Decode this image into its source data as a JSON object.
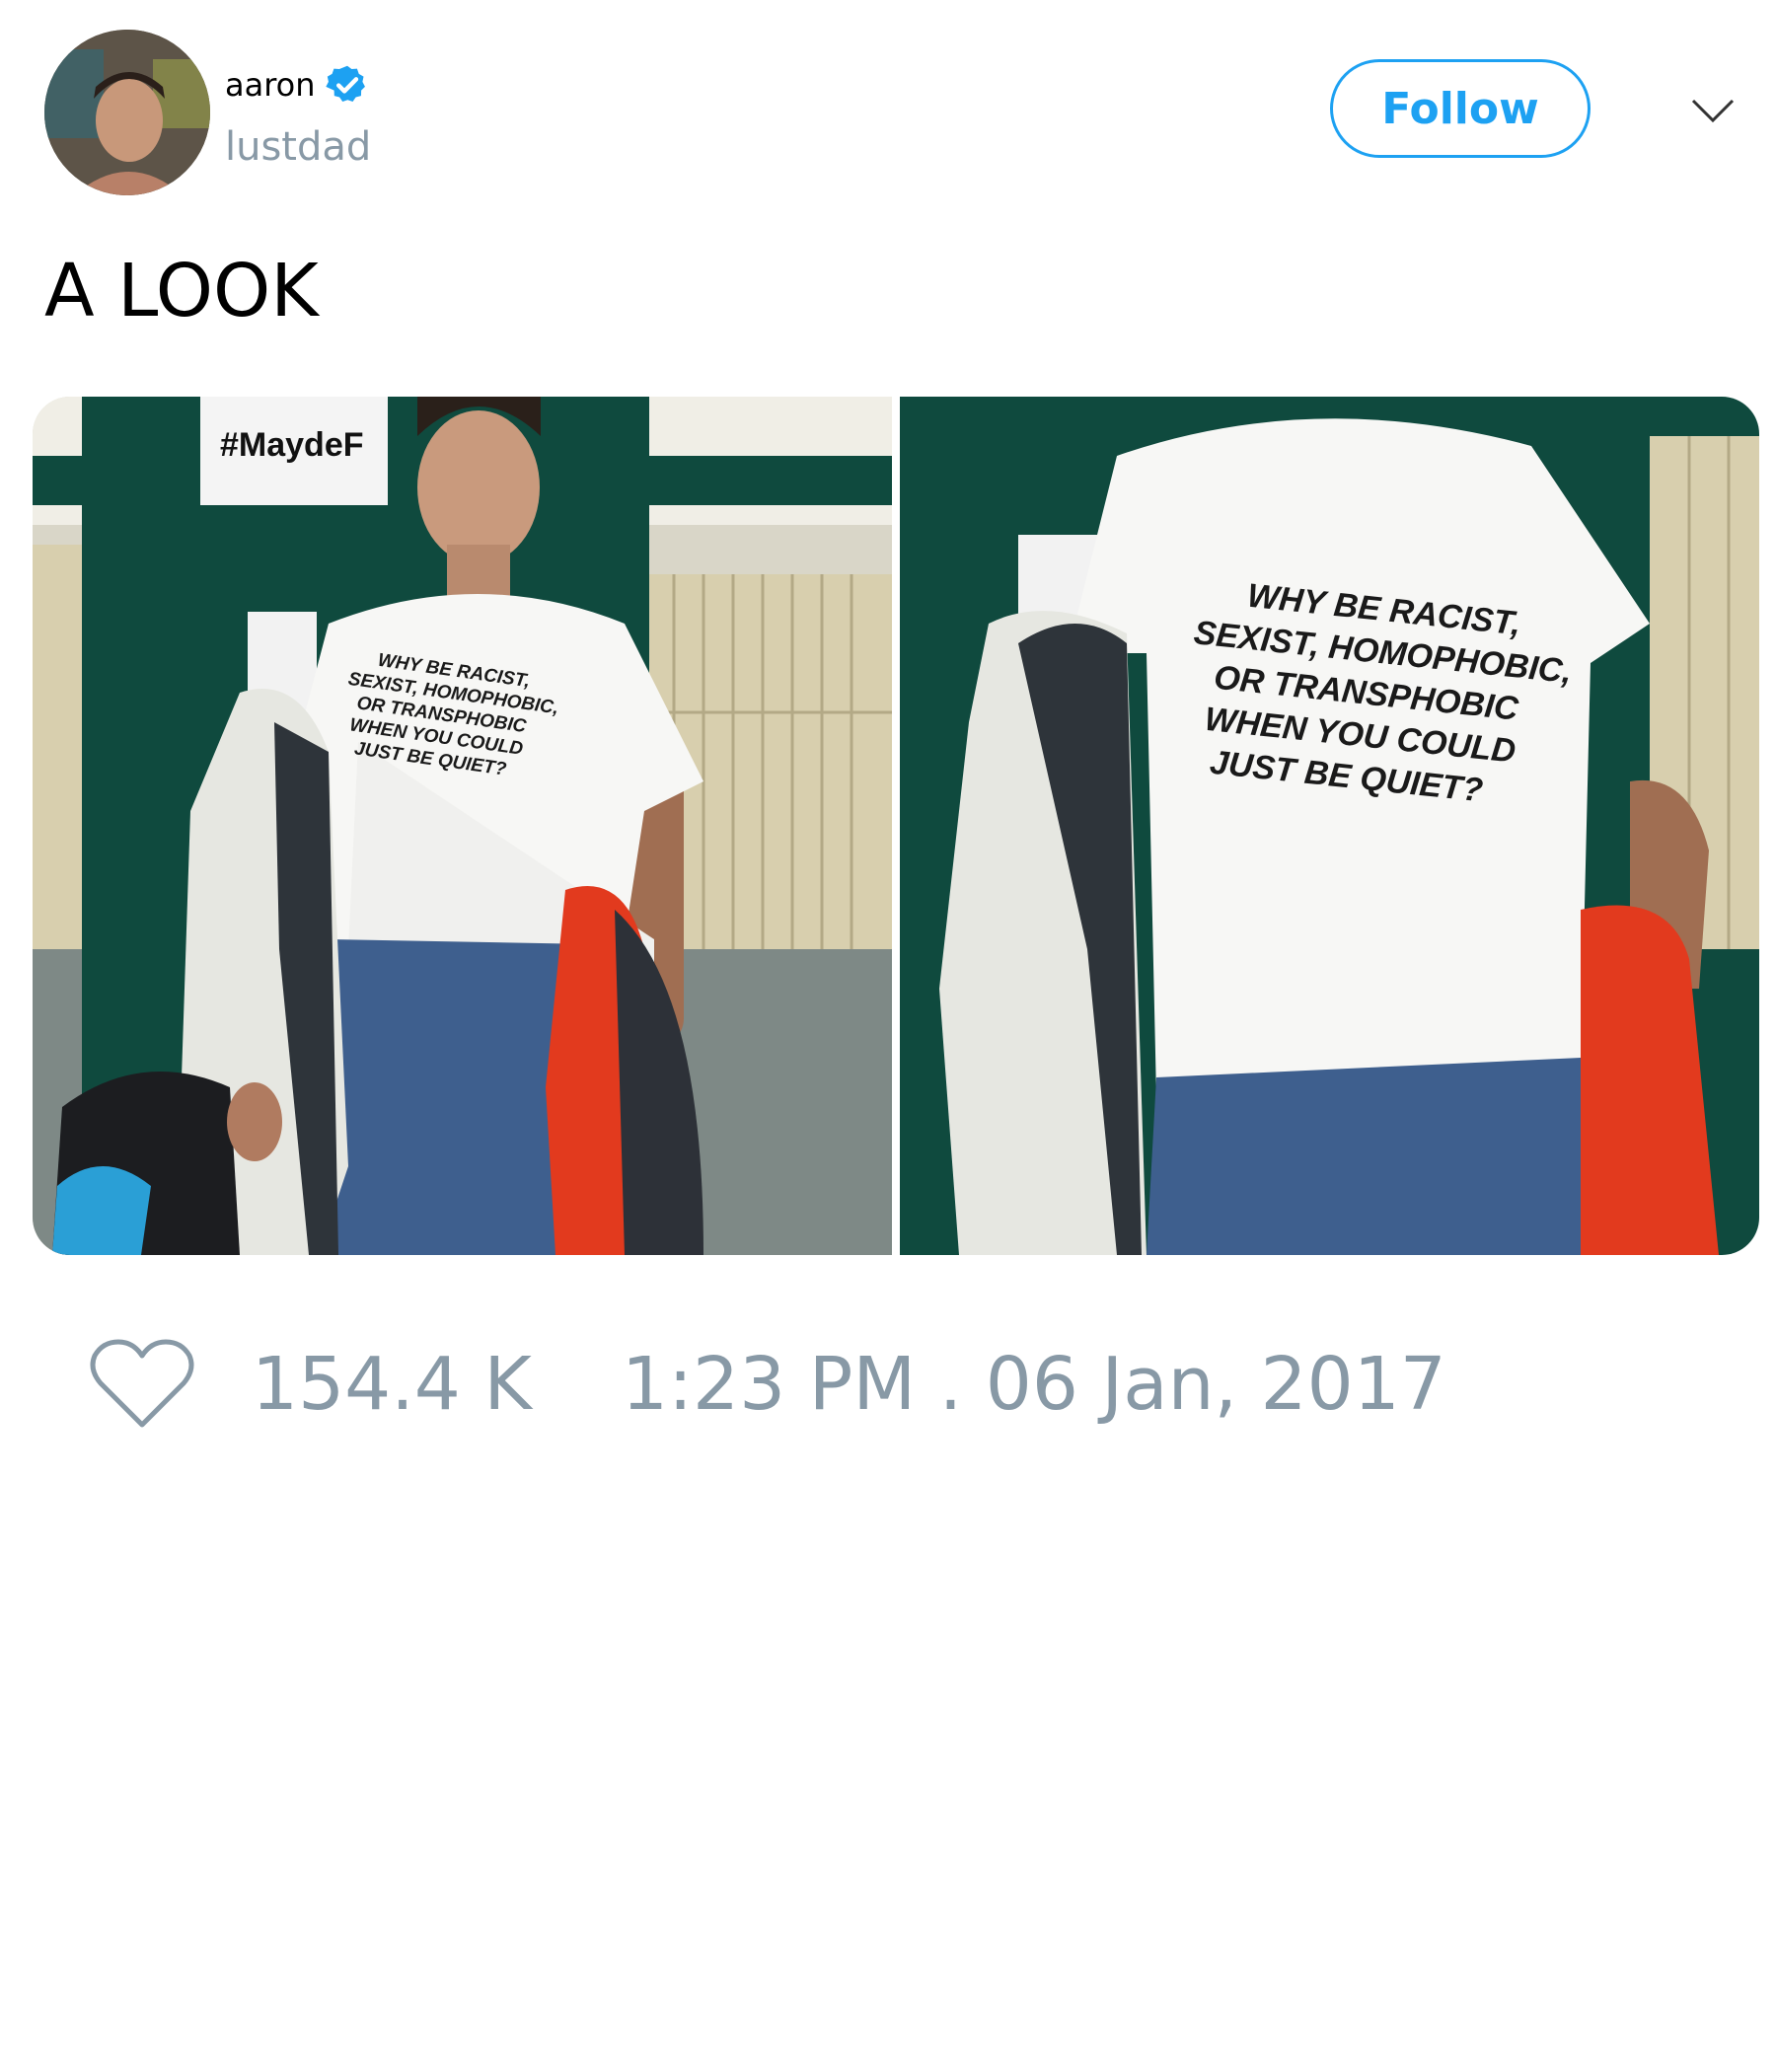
{
  "user": {
    "display_name": "aaron",
    "handle": "lustdad",
    "verified": true,
    "avatar_icon": "profile-photo"
  },
  "actions": {
    "follow_label": "Follow",
    "menu_icon": "chevron-down-icon"
  },
  "tweet": {
    "text": "A LOOK",
    "shirt_text": [
      "WHY BE RACIST,",
      "SEXIST, HOMOPHOBIC,",
      "OR TRANSPHOBIC",
      "WHEN YOU COULD",
      "JUST BE QUIET?"
    ],
    "banner_text": "#MaydeF"
  },
  "footer": {
    "likes": "154.4 K",
    "timestamp": "1:23 PM . 06 Jan, 2017",
    "like_icon": "heart-icon"
  },
  "colors": {
    "accent": "#1da1f2",
    "muted": "#8899a6",
    "verified": "#1da1f2"
  }
}
